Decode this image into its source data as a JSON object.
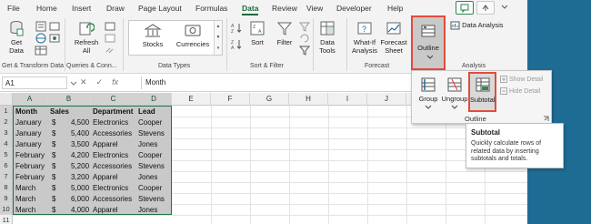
{
  "colors": {
    "accent_green": "#217346",
    "highlight_red": "#e34b3d",
    "side_strip": "#1e6c94"
  },
  "tabs": [
    "File",
    "Home",
    "Insert",
    "Draw",
    "Page Layout",
    "Formulas",
    "Data",
    "Review",
    "View",
    "Developer",
    "Help"
  ],
  "active_tab": "Data",
  "ribbon": {
    "get_data": {
      "label1": "Get",
      "label2": "Data"
    },
    "refresh": {
      "label1": "Refresh",
      "label2": "All"
    },
    "data_types": {
      "stocks": "Stocks",
      "currencies": "Currencies"
    },
    "sort": "Sort",
    "filter": "Filter",
    "data_tools": {
      "label1": "Data",
      "label2": "Tools"
    },
    "what_if": {
      "label1": "What-If",
      "label2": "Analysis"
    },
    "forecast_sheet": {
      "label1": "Forecast",
      "label2": "Sheet"
    },
    "outline": "Outline",
    "data_analysis": "Data Analysis",
    "group_labels": {
      "get_transform": "Get & Transform Data",
      "queries": "Queries & Conn...",
      "data_types": "Data Types",
      "sort_filter": "Sort & Filter",
      "forecast": "Forecast",
      "analysis": "Analysis"
    }
  },
  "formula_bar": {
    "name_box": "A1",
    "fx": "fx",
    "value": "Month"
  },
  "grid": {
    "columns": [
      "A",
      "B",
      "C",
      "D",
      "E",
      "F",
      "G",
      "H",
      "I",
      "J",
      "K"
    ],
    "rows": [
      "1",
      "2",
      "3",
      "4",
      "5",
      "6",
      "7",
      "8",
      "9",
      "10",
      "11"
    ],
    "header": {
      "month": "Month",
      "sales": "Sales",
      "department": "Department",
      "lead": "Lead"
    },
    "data": [
      {
        "month": "January",
        "currency": "$",
        "sales": "4,500",
        "department": "Electronics",
        "lead": "Cooper"
      },
      {
        "month": "January",
        "currency": "$",
        "sales": "5,400",
        "department": "Accessories",
        "lead": "Stevens"
      },
      {
        "month": "January",
        "currency": "$",
        "sales": "3,500",
        "department": "Apparel",
        "lead": "Jones"
      },
      {
        "month": "February",
        "currency": "$",
        "sales": "4,200",
        "department": "Electronics",
        "lead": "Cooper"
      },
      {
        "month": "February",
        "currency": "$",
        "sales": "5,200",
        "department": "Accessories",
        "lead": "Stevens"
      },
      {
        "month": "February",
        "currency": "$",
        "sales": "3,200",
        "department": "Apparel",
        "lead": "Jones"
      },
      {
        "month": "March",
        "currency": "$",
        "sales": "5,000",
        "department": "Electronics",
        "lead": "Cooper"
      },
      {
        "month": "March",
        "currency": "$",
        "sales": "6,000",
        "department": "Accessories",
        "lead": "Stevens"
      },
      {
        "month": "March",
        "currency": "$",
        "sales": "4,000",
        "department": "Apparel",
        "lead": "Jones"
      }
    ]
  },
  "outline_panel": {
    "group": "Group",
    "ungroup": "Ungroup",
    "subtotal": "Subtotal",
    "show_detail": "Show Detail",
    "hide_detail": "Hide Detail",
    "label": "Outline"
  },
  "tooltip": {
    "title": "Subtotal",
    "body": "Quickly calculate rows of related data by inserting subtotals and totals."
  }
}
